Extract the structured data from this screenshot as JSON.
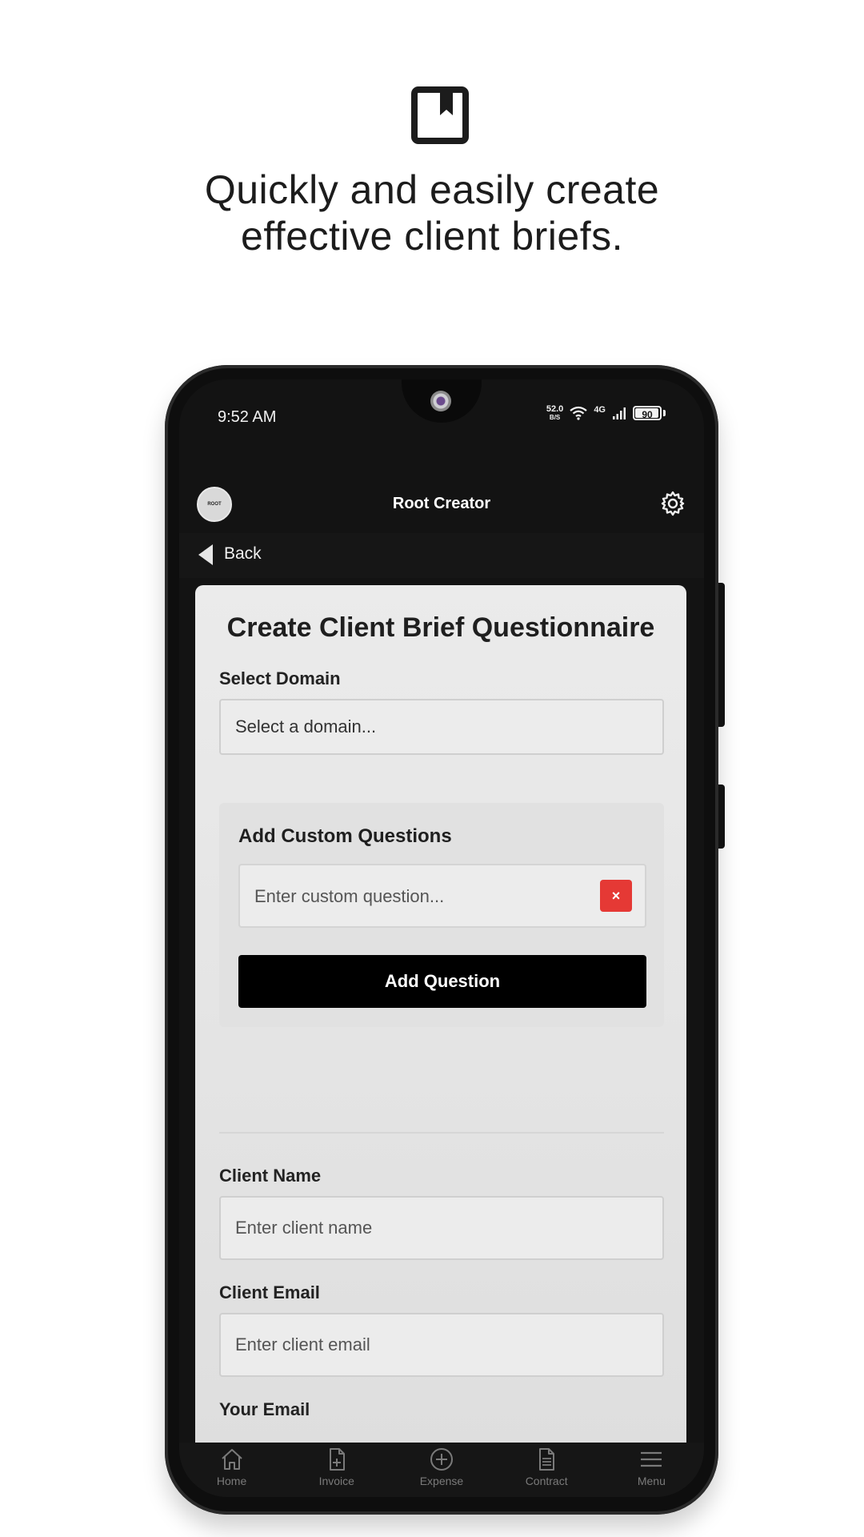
{
  "promo": {
    "line1": "Quickly and easily create",
    "line2": "effective client briefs.",
    "icon": "bookmark-icon"
  },
  "status_bar": {
    "time": "9:52 AM",
    "net_speed": "52.0",
    "net_unit": "B/S",
    "network": "4G",
    "battery": "90"
  },
  "app_bar": {
    "logo_text": "ROOT",
    "title": "Root Creator",
    "settings_icon": "gear-icon"
  },
  "back": {
    "label": "Back"
  },
  "form": {
    "title": "Create Client Brief Questionnaire",
    "domain_label": "Select Domain",
    "domain_selected": "Select a domain...",
    "custom": {
      "title": "Add Custom Questions",
      "placeholder": "Enter custom question...",
      "remove_label": "×",
      "add_label": "Add Question"
    },
    "client_name_label": "Client Name",
    "client_name_placeholder": "Enter client name",
    "client_email_label": "Client Email",
    "client_email_placeholder": "Enter client email",
    "your_email_label": "Your Email"
  },
  "nav": {
    "items": [
      {
        "label": "Home",
        "icon": "home-icon"
      },
      {
        "label": "Invoice",
        "icon": "invoice-icon"
      },
      {
        "label": "Expense",
        "icon": "plus-circle-icon"
      },
      {
        "label": "Contract",
        "icon": "document-icon"
      },
      {
        "label": "Menu",
        "icon": "menu-icon"
      }
    ]
  },
  "colors": {
    "accent_red": "#e53935",
    "primary_button": "#000000",
    "card_bg": "#ebebeb"
  }
}
